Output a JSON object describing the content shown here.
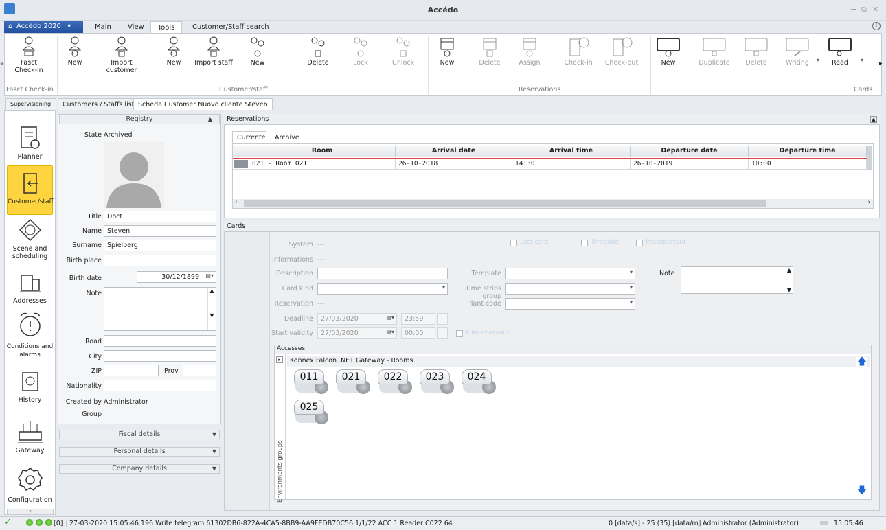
{
  "window": {
    "title": "Accédo"
  },
  "menu": {
    "app_button": "Accédo 2020",
    "tabs": [
      "Main",
      "View",
      "Tools",
      "Customer/Staff search"
    ]
  },
  "ribbon": {
    "buttons": [
      {
        "label": "Fasct\nCheck-in",
        "icon": "fast-checkin-icon",
        "enabled": true
      },
      {
        "label": "New",
        "icon": "new-customer-icon",
        "enabled": true
      },
      {
        "label": "Import\ncustomer",
        "icon": "import-customer-icon",
        "enabled": true
      },
      {
        "label": "New",
        "icon": "new-staff-icon",
        "enabled": true
      },
      {
        "label": "Import staff",
        "icon": "import-staff-icon",
        "enabled": true
      },
      {
        "label": "New",
        "icon": "new-group-icon",
        "enabled": true
      },
      {
        "label": "Delete",
        "icon": "delete-group-icon",
        "enabled": true
      },
      {
        "label": "Lock",
        "icon": "lock-icon",
        "enabled": false
      },
      {
        "label": "Unlock",
        "icon": "unlock-icon",
        "enabled": false
      },
      {
        "label": "New",
        "icon": "new-reservation-icon",
        "enabled": true
      },
      {
        "label": "Delete",
        "icon": "delete-reservation-icon",
        "enabled": false
      },
      {
        "label": "Assign",
        "icon": "assign-icon",
        "enabled": false
      },
      {
        "label": "Check-in",
        "icon": "check-in-icon",
        "enabled": false
      },
      {
        "label": "Check-out",
        "icon": "check-out-icon",
        "enabled": false
      },
      {
        "label": "New",
        "icon": "new-card-icon",
        "enabled": true
      },
      {
        "label": "Duplicate",
        "icon": "duplicate-card-icon",
        "enabled": false
      },
      {
        "label": "Delete",
        "icon": "delete-card-icon",
        "enabled": false
      },
      {
        "label": "Writing",
        "icon": "write-card-icon",
        "enabled": false
      },
      {
        "label": "Read",
        "icon": "read-card-icon",
        "enabled": true
      }
    ],
    "groups": [
      "Fasct Check-in",
      "Customer/staff",
      "Reservations",
      "Cards"
    ]
  },
  "doc_tabs": [
    "Supervisioning",
    "Customers / Staffs list",
    "Scheda Customer Nuovo cliente Steven"
  ],
  "nav": [
    {
      "label": "Planner",
      "icon": "planner-icon"
    },
    {
      "label": "Customer/staff",
      "icon": "customer-staff-icon"
    },
    {
      "label": "Scene and\nscheduling",
      "icon": "scene-icon"
    },
    {
      "label": "Addresses",
      "icon": "addresses-icon"
    },
    {
      "label": "Conditions and\nalarms",
      "icon": "alarm-clock-icon"
    },
    {
      "label": "History",
      "icon": "history-icon"
    },
    {
      "label": "Gateway",
      "icon": "gateway-icon"
    },
    {
      "label": "Configuration",
      "icon": "gear-icon"
    }
  ],
  "registry": {
    "header": "Registry",
    "state_label": "State",
    "state_value": "Archived",
    "title_label": "Title",
    "title_value": "Doct",
    "name_label": "Name",
    "name_value": "Steven",
    "surname_label": "Surname",
    "surname_value": "Spielberg",
    "birth_place_label": "Birth place",
    "birth_place_value": "",
    "birth_date_label": "Birth date",
    "birth_date_value": "30/12/1899",
    "note_label": "Note",
    "road_label": "Road",
    "city_label": "City",
    "zip_label": "ZIP",
    "prov_label": "Prov.",
    "nationality_label": "Nationality",
    "created_by_label": "Created by",
    "created_by_value": "Administrator",
    "group_label": "Group"
  },
  "sections": [
    "Fiscal details",
    "Personal details",
    "Company details"
  ],
  "reservations": {
    "header": "Reservations",
    "tabs": [
      "Currente",
      "Archive"
    ],
    "columns": [
      "Room",
      "Arrival date",
      "Arrival time",
      "Departure date",
      "Departure time"
    ],
    "rows": [
      [
        "021 - Room 021",
        "26-10-2018",
        "14:30",
        "26-10-2019",
        "10:00"
      ]
    ]
  },
  "cards": {
    "header": "Cards",
    "system_label": "System",
    "system_value": "---",
    "info_label": "Informations",
    "info_value": "---",
    "description_label": "Description",
    "card_kind_label": "Card kind",
    "reservation_label": "Reservation",
    "reservation_value": "---",
    "deadline_label": "Deadline",
    "deadline_date": "27/03/2020",
    "deadline_time": "23:59",
    "start_label": "Start validity",
    "start_date": "27/03/2020",
    "start_time": "00:00",
    "template_label": "Template",
    "time_strips_label": "Time strips group",
    "plant_code_label": "Plant code",
    "note_label": "Note",
    "checks": [
      "Last card",
      "Template",
      "Passepartout",
      "Auto checkout"
    ]
  },
  "accesses": {
    "header": "Accesses",
    "side_label": "Environments groups",
    "gateway": "Konnex Falcon .NET Gateway - Rooms",
    "rooms": [
      "011",
      "021",
      "022",
      "023",
      "024",
      "025"
    ]
  },
  "status": {
    "counter": "[0]",
    "log": "27-03-2020 15:05:46.196 Write telegram 61302DB6-822A-4CA5-8BB9-AA9FEDB70C56 1/1/22 ACC 1 Reader C022 64",
    "rate": "0 [data/s] - 25 (35) [data/m]",
    "user": "Administrator (Administrator)",
    "time": "15:05:46"
  }
}
